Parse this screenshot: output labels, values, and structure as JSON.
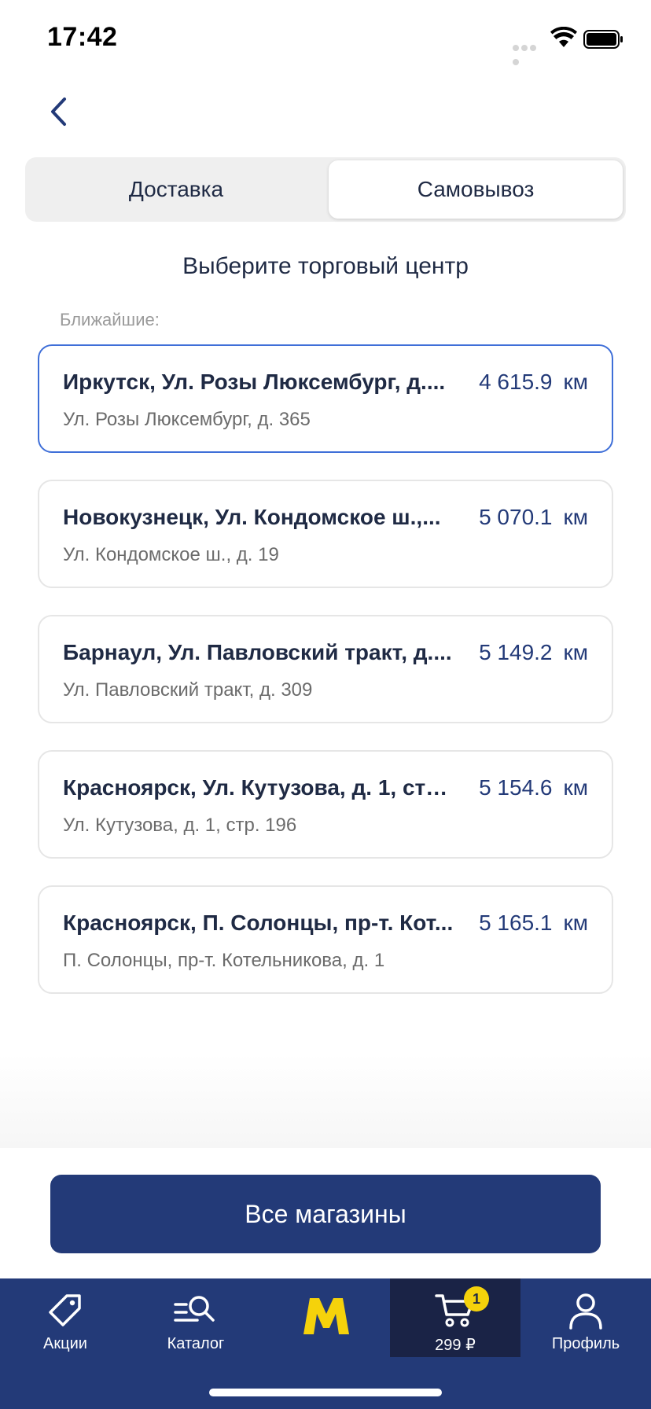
{
  "status_bar": {
    "time": "17:42"
  },
  "header": {
    "back_icon": "chevron-left-icon"
  },
  "segmented_control": {
    "options": [
      {
        "label": "Доставка",
        "selected": false
      },
      {
        "label": "Самовывоз",
        "selected": true
      }
    ]
  },
  "title": "Выберите торговый центр",
  "nearby_label": "Ближайшие:",
  "stores": [
    {
      "name": "Иркутск, Ул. Розы Люксембург, д....",
      "address": "Ул. Розы Люксембург, д. 365",
      "distance": "4 615.9",
      "unit": "км",
      "selected": true
    },
    {
      "name": "Новокузнецк, Ул. Кондомское ш.,...",
      "address": "Ул. Кондомское ш., д. 19",
      "distance": "5 070.1",
      "unit": "км",
      "selected": false
    },
    {
      "name": "Барнаул, Ул. Павловский тракт, д....",
      "address": "Ул. Павловский тракт, д. 309",
      "distance": "5 149.2",
      "unit": "км",
      "selected": false
    },
    {
      "name": "Красноярск, Ул. Кутузова, д. 1, стр...",
      "address": "Ул. Кутузова, д. 1, стр. 196",
      "distance": "5 154.6",
      "unit": "км",
      "selected": false
    },
    {
      "name": "Красноярск, П. Солонцы, пр-т. Кот...",
      "address": "П. Солонцы, пр-т. Котельникова, д. 1",
      "distance": "5 165.1",
      "unit": "км",
      "selected": false
    }
  ],
  "all_stores_button": "Все магазины",
  "tab_bar": {
    "items": [
      {
        "label": "Акции",
        "icon": "tag-icon"
      },
      {
        "label": "Каталог",
        "icon": "catalog-search-icon"
      },
      {
        "label": "",
        "icon": "m-logo-icon"
      },
      {
        "label": "299 ₽",
        "icon": "cart-icon",
        "badge": "1"
      },
      {
        "label": "Профиль",
        "icon": "profile-icon"
      }
    ]
  },
  "colors": {
    "brand": "#233a78",
    "accent_yellow": "#f5d20b",
    "selected_border": "#3f6fd8"
  }
}
